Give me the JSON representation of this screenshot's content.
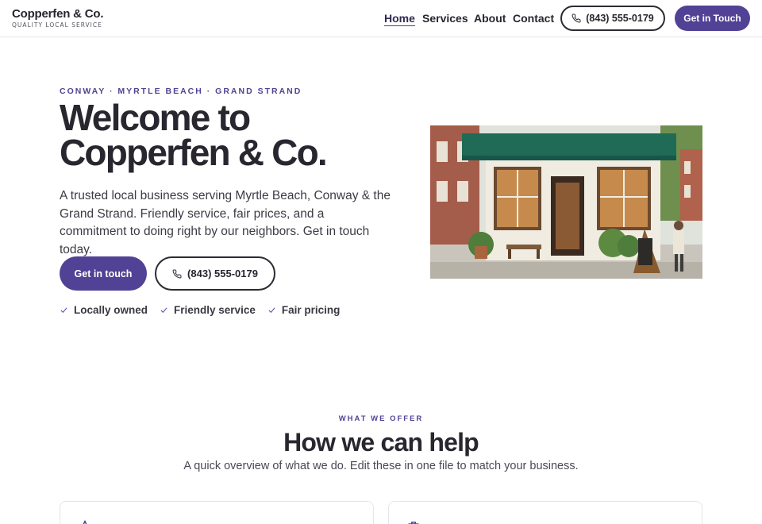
{
  "brand": {
    "name": "Copperfen & Co.",
    "tagline": "QUALITY LOCAL SERVICE"
  },
  "nav": {
    "home": "Home",
    "services": "Services",
    "about": "About",
    "contact": "Contact"
  },
  "header": {
    "phone": "(843) 555-0179",
    "cta": "Get in Touch"
  },
  "hero": {
    "eyebrow": "CONWAY · MYRTLE BEACH · GRAND STRAND",
    "title_line1": "Welcome to",
    "title_line2": "Copperfen & Co.",
    "description": "A trusted local business serving Myrtle Beach, Conway & the Grand Strand. Friendly service, fair prices, and a commitment to doing right by our neighbors. Get in touch today.",
    "primary_button": "Get in touch",
    "phone_button": "(843) 555-0179",
    "features": [
      "Locally owned",
      "Friendly service",
      "Fair pricing"
    ]
  },
  "offer": {
    "eyebrow": "WHAT WE OFFER",
    "title": "How we can help",
    "subtitle": "A quick overview of what we do. Edit these in one file to match your business."
  },
  "colors": {
    "accent": "#524295",
    "text": "#28262f",
    "awning": "#1f6b55"
  },
  "icons": {
    "phone": "phone-icon",
    "check": "check-icon",
    "card1": "star-icon",
    "card2": "briefcase-icon"
  }
}
